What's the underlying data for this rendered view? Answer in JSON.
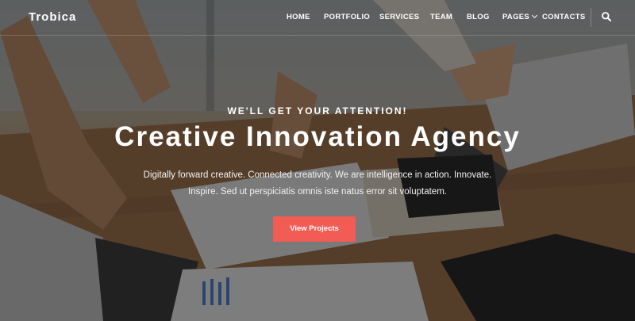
{
  "brand": {
    "name": "Trobica"
  },
  "nav": {
    "items": [
      {
        "label": "HOME"
      },
      {
        "label": "PORTFOLIO"
      },
      {
        "label": "SERVICES"
      },
      {
        "label": "TEAM"
      },
      {
        "label": "BLOG"
      },
      {
        "label": "PAGES",
        "dropdown": true
      },
      {
        "label": "CONTACTS"
      }
    ],
    "search_icon": "search-icon"
  },
  "hero": {
    "kicker": "WE'LL GET YOUR ATTENTION!",
    "title": "Creative Innovation Agency",
    "description_line1": "Digitally forward creative. Connected creativity. We are intelligence in action. Innovate.",
    "description_line2": "Inspire. Sed ut perspiciatis omnis iste natus error sit voluptatem.",
    "cta_label": "View Projects"
  },
  "colors": {
    "accent": "#f25c54",
    "text": "#ffffff",
    "overlay": "rgba(28,26,25,0.55)"
  }
}
